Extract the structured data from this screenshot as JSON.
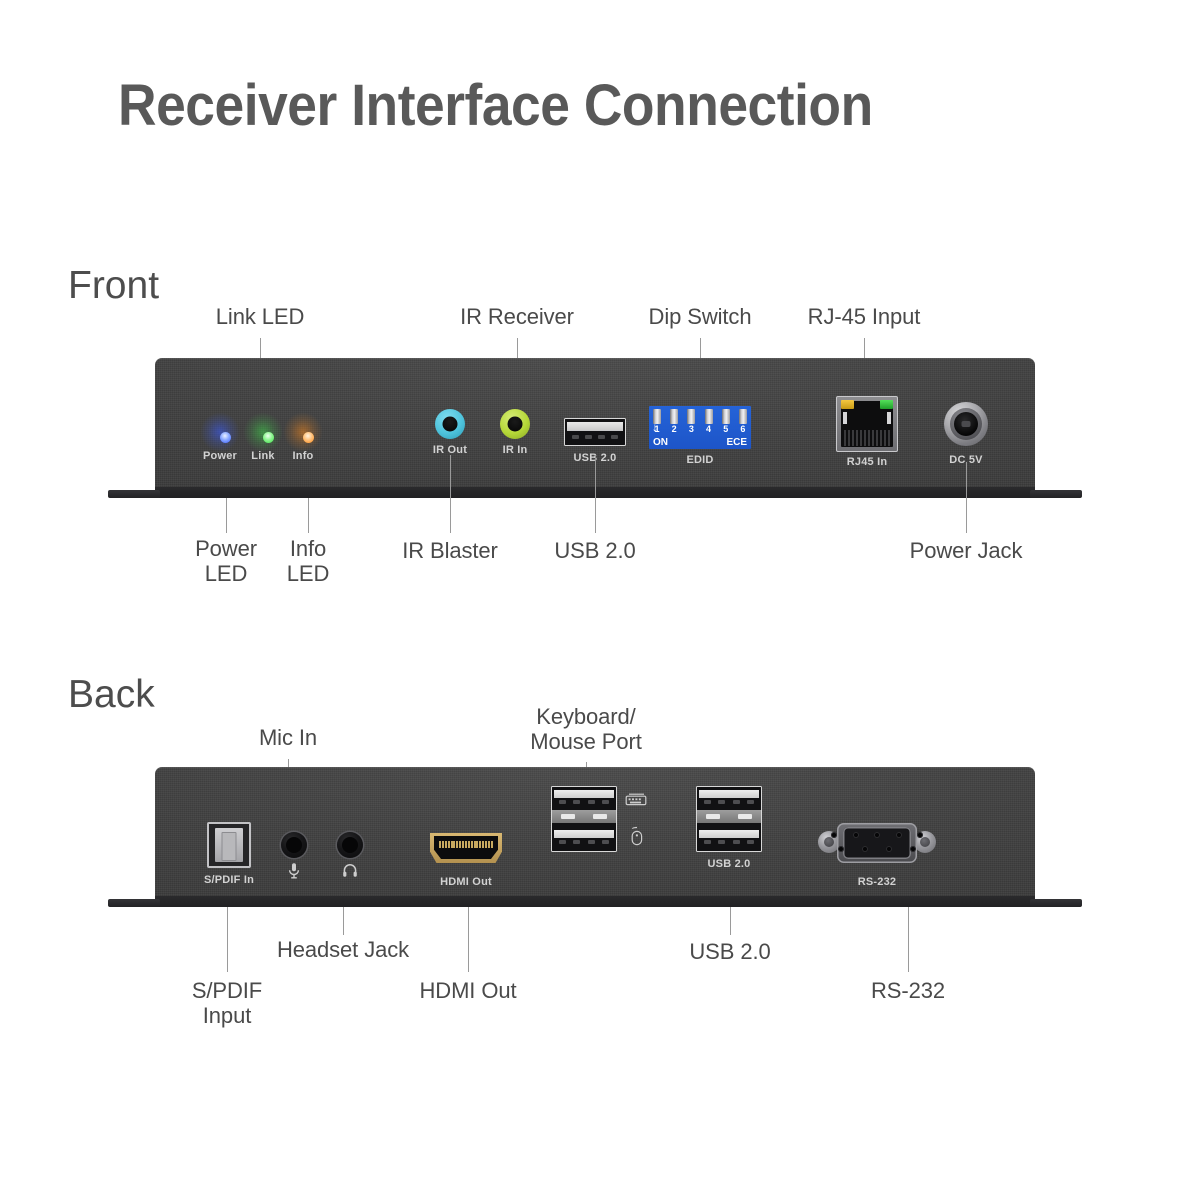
{
  "title": "Receiver Interface Connection",
  "sections": {
    "front_heading": "Front",
    "back_heading": "Back"
  },
  "colors": {
    "title": "#595959",
    "heading": "#4d4d4d",
    "callout": "#4a4a4a",
    "leader_line": "#9a9a9a",
    "chassis": "#414141",
    "led_power": "#3a5cff",
    "led_link": "#3ee04a",
    "led_info": "#ff8c1a",
    "ir_out_ring": "#4ec3dc",
    "ir_in_ring": "#b5d838",
    "dip_switch": "#2563d8",
    "rj45_led_left": "#f5c842",
    "rj45_led_right": "#54e05a",
    "hdmi_gold": "#c8a95f"
  },
  "front": {
    "callouts_top": [
      {
        "label": "Link LED",
        "icon": "leader-line"
      },
      {
        "label": "IR Receiver",
        "icon": "leader-line"
      },
      {
        "label": "Dip Switch",
        "icon": "leader-line"
      },
      {
        "label": "RJ-45 Input",
        "icon": "leader-line"
      }
    ],
    "callouts_bottom": [
      {
        "label": "Power\nLED",
        "icon": "leader-line"
      },
      {
        "label": "Info\nLED",
        "icon": "leader-line"
      },
      {
        "label": "IR Blaster",
        "icon": "leader-line"
      },
      {
        "label": "USB 2.0",
        "icon": "leader-line"
      },
      {
        "label": "Power Jack",
        "icon": "leader-line"
      }
    ],
    "panel": {
      "leds": [
        {
          "name": "Power",
          "color": "#3a5cff"
        },
        {
          "name": "Link",
          "color": "#3ee04a"
        },
        {
          "name": "Info",
          "color": "#ff8c1a"
        }
      ],
      "ir_out_label": "IR Out",
      "ir_in_label": "IR In",
      "usb_label": "USB 2.0",
      "dip": {
        "label": "EDID",
        "numbers": [
          "1",
          "2",
          "3",
          "4",
          "5",
          "6"
        ],
        "on_label": "ON",
        "ece_label": "ECE",
        "arrow_icon": "down-arrow-icon"
      },
      "rj45_label": "RJ45 In",
      "dc_label": "DC 5V"
    }
  },
  "back": {
    "callouts_top": [
      {
        "label": "Mic In",
        "icon": "leader-line"
      },
      {
        "label": "Keyboard/\nMouse Port",
        "icon": "leader-line"
      }
    ],
    "callouts_bottom": [
      {
        "label": "S/PDIF\nInput",
        "icon": "leader-line"
      },
      {
        "label": "Headset Jack",
        "icon": "leader-line"
      },
      {
        "label": "HDMI Out",
        "icon": "leader-line"
      },
      {
        "label": "USB 2.0",
        "icon": "leader-line"
      },
      {
        "label": "RS-232",
        "icon": "leader-line"
      }
    ],
    "panel": {
      "spdif_label": "S/PDIF In",
      "mic_icon": "microphone-icon",
      "headphone_icon": "headphone-icon",
      "hdmi_label": "HDMI Out",
      "keyboard_icon": "keyboard-icon",
      "mouse_icon": "mouse-icon",
      "usb_label": "USB 2.0",
      "rs232_label": "RS-232"
    }
  }
}
